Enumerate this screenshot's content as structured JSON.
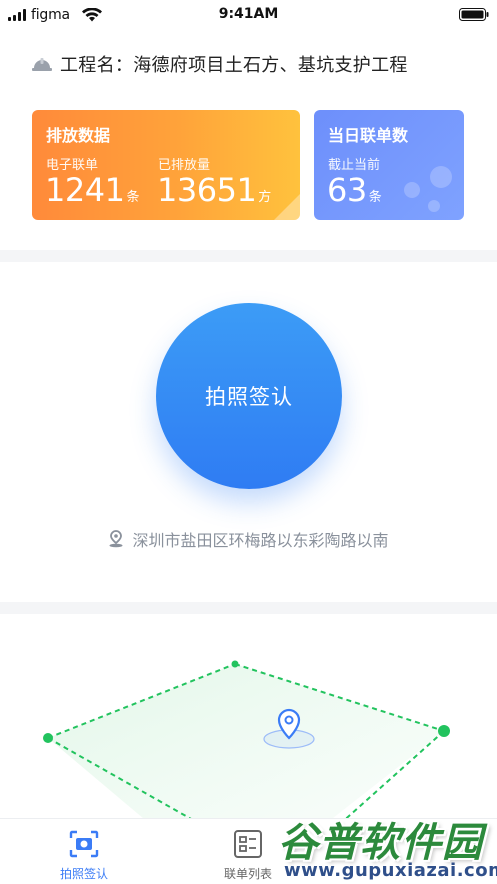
{
  "status_bar": {
    "carrier": "figma",
    "time": "9:41AM"
  },
  "project": {
    "label": "工程名：海德府项目土石方、基坑支护工程",
    "icon": "helmet-icon"
  },
  "discharge_card": {
    "title": "排放数据",
    "electronic_label": "电子联单",
    "electronic_value": "1241",
    "electronic_unit": "条",
    "discharged_label": "已排放量",
    "discharged_value": "13651",
    "discharged_unit": "方"
  },
  "daily_card": {
    "title": "当日联单数",
    "sub_label": "截止当前",
    "value": "63",
    "unit": "条"
  },
  "capture": {
    "button_label": "拍照签认"
  },
  "location": {
    "address": "深圳市盐田区环梅路以东彩陶路以南",
    "icon": "location-pin-icon"
  },
  "tabs": [
    {
      "label": "拍照签认",
      "icon": "camera-scan-icon",
      "active": true
    },
    {
      "label": "联单列表",
      "icon": "list-icon",
      "active": false
    }
  ],
  "watermark": {
    "line1": "谷普软件园",
    "line2": "www.gupuxiazai.com"
  },
  "colors": {
    "primary_blue": "#3b7cf6",
    "orange_start": "#ff8a3a",
    "orange_end": "#ffc23d",
    "fence_green": "#22c35e"
  }
}
